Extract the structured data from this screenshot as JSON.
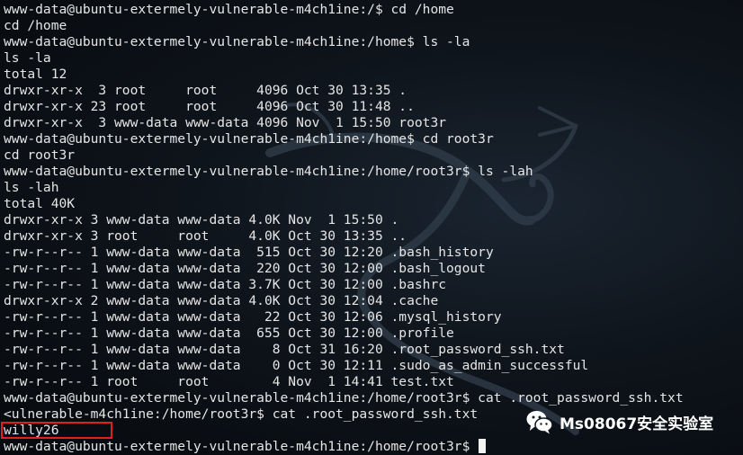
{
  "terminal": {
    "lines": [
      "www-data@ubuntu-extermely-vulnerable-m4ch1ine:/$ cd /home",
      "cd /home",
      "www-data@ubuntu-extermely-vulnerable-m4ch1ine:/home$ ls -la",
      "ls -la",
      "total 12",
      "drwxr-xr-x  3 root     root     4096 Oct 30 13:35 .",
      "drwxr-xr-x 23 root     root     4096 Oct 30 11:48 ..",
      "drwxr-xr-x  3 www-data www-data 4096 Nov  1 15:50 root3r",
      "www-data@ubuntu-extermely-vulnerable-m4ch1ine:/home$ cd root3r",
      "cd root3r",
      "www-data@ubuntu-extermely-vulnerable-m4ch1ine:/home/root3r$ ls -lah",
      "ls -lah",
      "total 40K",
      "drwxr-xr-x 3 www-data www-data 4.0K Nov  1 15:50 .",
      "drwxr-xr-x 3 root     root     4.0K Oct 30 13:35 ..",
      "-rw-r--r-- 1 www-data www-data  515 Oct 30 12:20 .bash_history",
      "-rw-r--r-- 1 www-data www-data  220 Oct 30 12:00 .bash_logout",
      "-rw-r--r-- 1 www-data www-data 3.7K Oct 30 12:00 .bashrc",
      "drwxr-xr-x 2 www-data www-data 4.0K Oct 30 12:04 .cache",
      "-rw-r--r-- 1 www-data www-data   22 Oct 30 12:06 .mysql_history",
      "-rw-r--r-- 1 www-data www-data  655 Oct 30 12:00 .profile",
      "-rw-r--r-- 1 www-data www-data    8 Oct 31 16:20 .root_password_ssh.txt",
      "-rw-r--r-- 1 www-data www-data    0 Oct 30 12:11 .sudo_as_admin_successful",
      "-rw-r--r-- 1 root     root        4 Nov  1 14:41 test.txt",
      "www-data@ubuntu-extermely-vulnerable-m4ch1ine:/home/root3r$ cat .root_password_ssh.txt",
      "<ulnerable-m4ch1ine:/home/root3r$ cat .root_password_ssh.txt",
      "willy26",
      "www-data@ubuntu-extermely-vulnerable-m4ch1ine:/home/root3r$ "
    ]
  },
  "watermark": {
    "text": "Ms08067安全实验室",
    "icon": "wechat-icon"
  },
  "colors": {
    "background": "#0e141b",
    "text": "#e6e6e6",
    "highlight": "#e02020"
  }
}
